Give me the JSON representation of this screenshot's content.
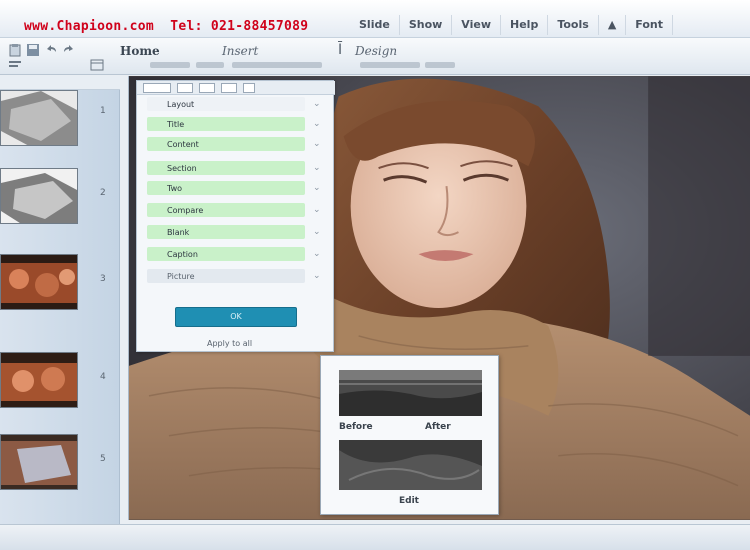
{
  "watermark": "www.Chapioon.com  Tel: 021-88457089",
  "menu": [
    "Slide",
    "Show",
    "View",
    "Help",
    "Tools",
    "▲",
    "Font"
  ],
  "ribbon": {
    "home_tab": "Home",
    "insert_tab": "Insert",
    "design_tab": "Design"
  },
  "dialog": {
    "options": [
      "Layout",
      "Title",
      "Content",
      "Section",
      "Two",
      "Compare",
      "Blank",
      "Caption",
      "Picture"
    ],
    "ok_label": "OK",
    "footer": "Apply to all"
  },
  "preview": {
    "left_label": "Before",
    "right_label": "After",
    "bottom_label": "Edit"
  },
  "sidebar": {
    "thumb_numbers": [
      "1",
      "2",
      "3",
      "4",
      "5"
    ]
  },
  "colors": {
    "watermark": "#d0021b",
    "accent_button": "#1f8fb3",
    "option_highlight": "#c9f1c9"
  },
  "icons": {
    "close": "close-icon",
    "paste": "paste-icon",
    "save": "save-icon"
  }
}
